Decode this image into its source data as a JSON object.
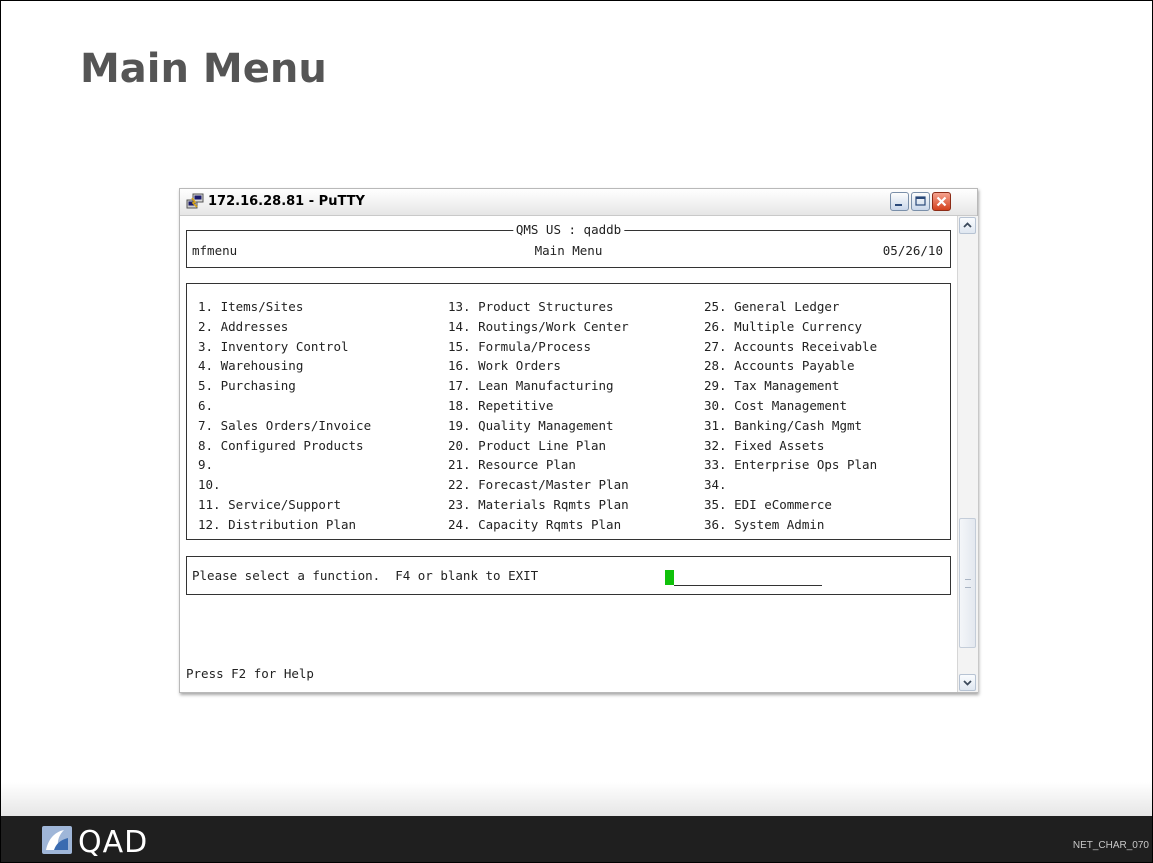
{
  "slide": {
    "title": "Main Menu",
    "footer_code": "NET_CHAR_070",
    "logo_text": "QAD"
  },
  "window": {
    "title": "172.16.28.81 - PuTTY"
  },
  "terminal": {
    "header_title": "QMS US : qaddb",
    "program": "mfmenu",
    "screen_title": "Main Menu",
    "date": "05/26/10",
    "menu_columns": [
      [
        "1. Items/Sites",
        "2. Addresses",
        "3. Inventory Control",
        "4. Warehousing",
        "5. Purchasing",
        "6.",
        "7. Sales Orders/Invoice",
        "8. Configured Products",
        "9.",
        "10.",
        "11. Service/Support",
        "12. Distribution Plan"
      ],
      [
        "13. Product Structures",
        "14. Routings/Work Center",
        "15. Formula/Process",
        "16. Work Orders",
        "17. Lean Manufacturing",
        "18. Repetitive",
        "19. Quality Management",
        "20. Product Line Plan",
        "21. Resource Plan",
        "22. Forecast/Master Plan",
        "23. Materials Rqmts Plan",
        "24. Capacity Rqmts Plan"
      ],
      [
        "25. General Ledger",
        "26. Multiple Currency",
        "27. Accounts Receivable",
        "28. Accounts Payable",
        "29. Tax Management",
        "30. Cost Management",
        "31. Banking/Cash Mgmt",
        "32. Fixed Assets",
        "33. Enterprise Ops Plan",
        "34.",
        "35. EDI eCommerce",
        "36. System Admin"
      ]
    ],
    "prompt": "Please select a function.  F4 or blank to EXIT",
    "input_value": "",
    "help": "Press F2 for Help"
  },
  "colors": {
    "cursor": "#10c10a",
    "title_text": "#555555",
    "footer_band": "#1f1f1f"
  },
  "icons": [
    "putty-app-icon",
    "minimize-icon",
    "maximize-icon",
    "close-icon",
    "scroll-up-arrow-icon",
    "scroll-down-arrow-icon",
    "qad-logo-mark"
  ]
}
